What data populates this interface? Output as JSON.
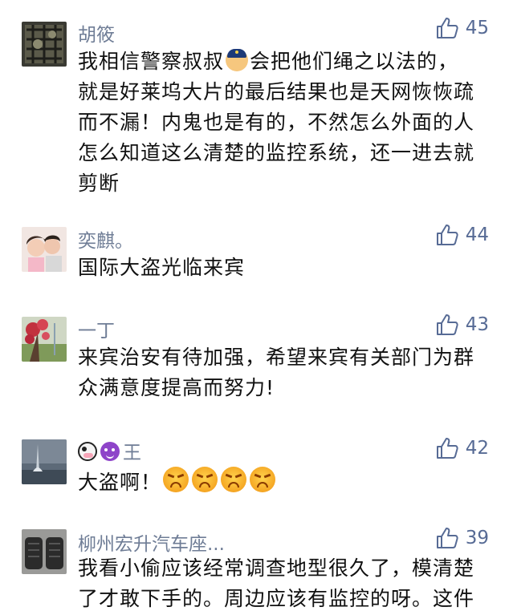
{
  "comments": [
    {
      "name": "胡筱",
      "likes": "45",
      "lines": [
        {
          "pre": "我相信警察叔叔",
          "emoji": "police-officer",
          "post": "会把他们绳之以法的，"
        },
        "就是好莱坞大片的最后结果也是天网恢恢疏",
        "而不漏！内鬼也是有的，不然怎么外面的人",
        "怎么知道这么清楚的监控系统，还一进去就",
        "剪断"
      ]
    },
    {
      "name": "奕麒。",
      "likes": "44",
      "lines": [
        "国际大盗光临来宾"
      ]
    },
    {
      "name": "一丁",
      "likes": "43",
      "lines": [
        "来宾治安有待加强，希望来宾有关部门为群",
        "众满意度提高而努力!"
      ]
    },
    {
      "name": "王",
      "name_prefix_emojis": [
        "cow-face",
        "smiling-devil"
      ],
      "likes": "42",
      "lines": [
        {
          "text": "大盗啊！",
          "emojis": [
            "angry-face",
            "angry-face",
            "angry-face",
            "angry-face"
          ]
        }
      ]
    },
    {
      "name": "柳州宏升汽车座...",
      "likes": "39",
      "lines": [
        "我看小偷应该经常调查地型很久了，模清楚",
        "了才敢下手的。周边应该有监控的呀。这件"
      ]
    }
  ],
  "colors": {
    "name": "#6f7d96",
    "like": "#576b95",
    "text": "#111111"
  }
}
